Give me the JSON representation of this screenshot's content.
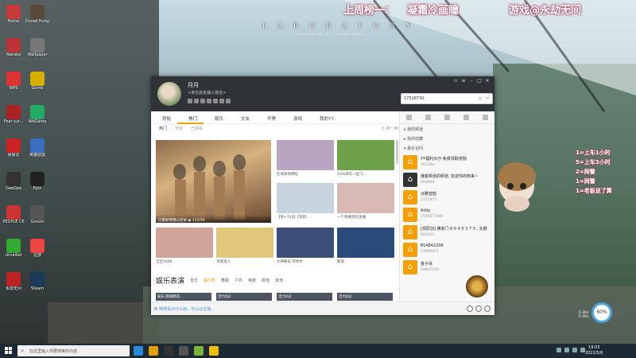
{
  "overlay": {
    "top_left": "上周榜一：",
    "top_left_name": "凝霜冷画瞳",
    "top_right": "游戏@永劫无间",
    "wallpaper_title": "L A B O R A T O R Y",
    "wallpaper_sub": "illustration by TS charos dance",
    "donor_lines": [
      "1=上车1小时",
      "5=上车3小时",
      "2=网警",
      "1=网警",
      "1=老板说了算"
    ]
  },
  "desktop_icons": [
    {
      "label": "Home",
      "color": "#c83a3a"
    },
    {
      "label": "Dread Hunger",
      "color": "#5a4a3a"
    },
    {
      "label": "Naraka",
      "color": "#b33"
    },
    {
      "label": "Wallpaper",
      "color": "#777"
    },
    {
      "label": "WPS",
      "color": "#d33"
    },
    {
      "label": "Game",
      "color": "#d7b000"
    },
    {
      "label": "Fear sur...",
      "color": "#a22"
    },
    {
      "label": "WeGame",
      "color": "#2a6"
    },
    {
      "label": "网易云",
      "color": "#c22"
    },
    {
      "label": "英雄联盟",
      "color": "#3a6fc0"
    },
    {
      "label": "GeeGee",
      "color": "#333"
    },
    {
      "label": "Epic",
      "color": "#222"
    },
    {
      "label": "PEOPLE CE",
      "color": "#c33"
    },
    {
      "label": "Groom",
      "color": "#555"
    },
    {
      "label": "Unrailed",
      "color": "#3a3"
    },
    {
      "label": "迅游",
      "color": "#e44"
    },
    {
      "label": "永劫无间",
      "color": "#b22"
    },
    {
      "label": "Steam",
      "color": "#1b3a5a"
    }
  ],
  "window": {
    "username": "月月",
    "signature": "<单击此处输入签名>",
    "search_value": "17518730",
    "tabs": [
      "导航",
      "热门",
      "娱乐",
      "交友",
      "开黑",
      "游戏",
      "我的YY"
    ],
    "active_tab": "热门",
    "subtabs": [
      "热门",
      "可识",
      "已观看"
    ],
    "refresh_label": "换一换",
    "big_card": {
      "caption": "已暴新哦哦以后依",
      "viewers": "115/36"
    },
    "cards": [
      {
        "title": "在线等你撩陪",
        "color": "#b9a5c2"
      },
      {
        "title": "5/16周年一起飞...",
        "color": "#6fa04a"
      },
      {
        "title": "【第+703】【贤新...",
        "color": "#c7d3de"
      },
      {
        "title": "一个快撞到的主播",
        "color": "#d9b9b3"
      },
      {
        "title": "宝宝1006",
        "color": "#cfa59a"
      },
      {
        "title": "深度迷人",
        "color": "#e0c77a"
      },
      {
        "title": "大神解说 带你弄",
        "color": "#3d4e7a"
      },
      {
        "title": "解放",
        "color": "#2b4a7a"
      }
    ],
    "entertainment": {
      "header": "娱乐表演",
      "items": [
        "音乐",
        "脱口秀",
        "舞蹈",
        "户外",
        "喊麦",
        "颜值",
        "其他"
      ],
      "active": "脱口秀"
    },
    "strips": [
      "娱乐 超级精选...",
      "活力DJ2",
      "活力DJ2",
      "活力DJ2"
    ],
    "chat_placeholder": "随便说点什么吧，可以@主播...",
    "side": {
      "groups": [
        "我的频道",
        "我的收藏",
        "最近访问"
      ],
      "rows": [
        {
          "name": "YY福利大厅-免费领取奖励",
          "id": "34238w",
          "type": "orange"
        },
        {
          "name": "播客频道的频道, 欢迎你的到来~",
          "id": "890898",
          "type": "dark"
        },
        {
          "name": "淡雅音韵",
          "id": "1751873",
          "type": "orange"
        },
        {
          "name": "Aiidy",
          "id": "1596877489",
          "type": "orange"
        },
        {
          "name": "[现原创] 佛家门 6 0 4 0 3 7 3 , 长期",
          "id": "604033",
          "type": "orange"
        },
        {
          "name": "814842206",
          "id": "37868921",
          "type": "orange"
        },
        {
          "name": "金子哥",
          "id": "59802329",
          "type": "orange"
        }
      ]
    }
  },
  "taskbar": {
    "search_placeholder": "在这里输入你要搜索的内容",
    "time": "19:03",
    "date": "2022/5/6",
    "app_colors": [
      "#2b88d8",
      "#e5a000",
      "#333",
      "#555",
      "#7cb33a",
      "#f0c000"
    ]
  },
  "gauge": {
    "value": "60%",
    "up": "0.1K/s",
    "down": "0.1K/s"
  }
}
